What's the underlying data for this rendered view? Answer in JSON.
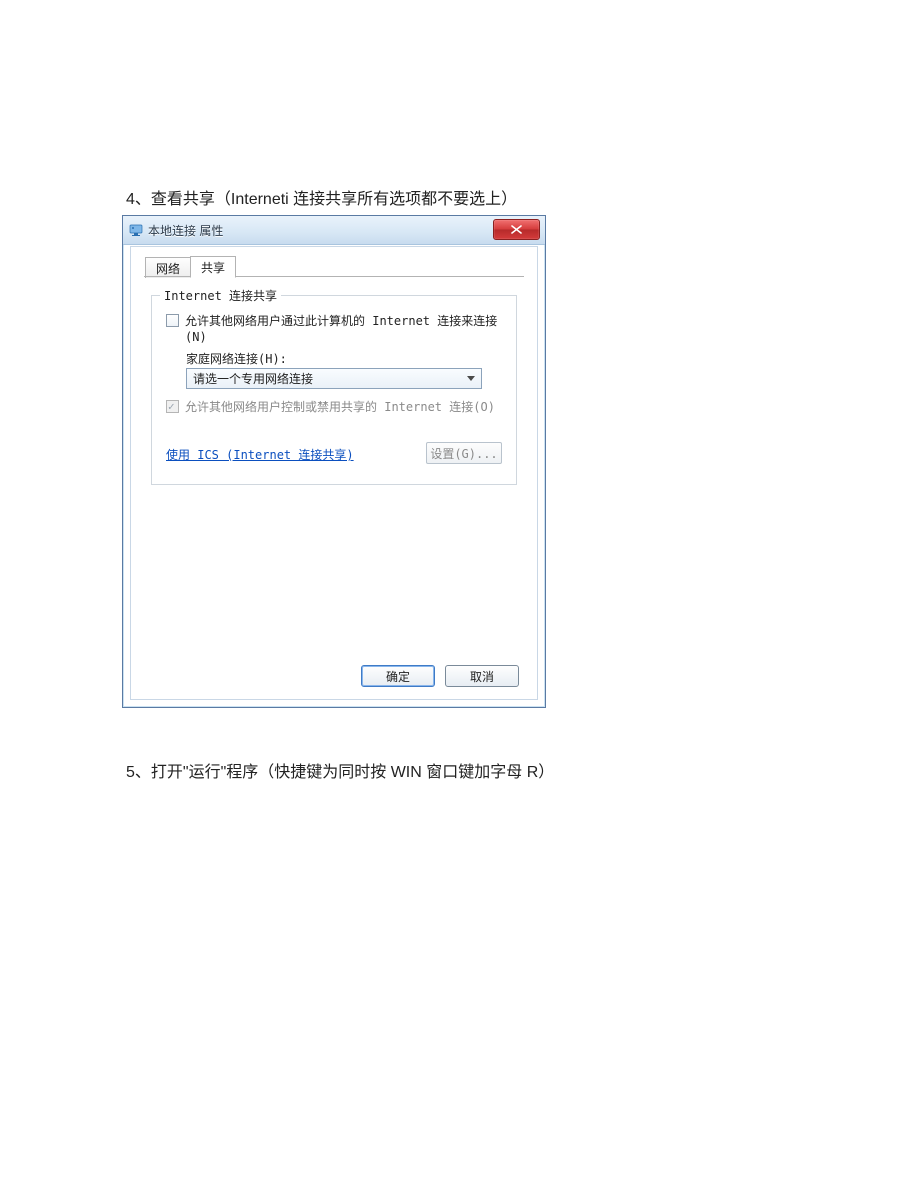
{
  "captions": {
    "step4": "4、查看共享（Interneti 连接共享所有选项都不要选上）",
    "step5": "5、打开\"运行\"程序（快捷键为同时按 WIN 窗口键加字母 R）"
  },
  "dialog": {
    "title": "本地连接 属性",
    "tabs": {
      "network": "网络",
      "share": "共享"
    },
    "group_title": "Internet 连接共享",
    "allow_through_label": "允许其他网络用户通过此计算机的 Internet 连接来连接(N)",
    "home_network_label": "家庭网络连接(H):",
    "combo_value": "请选一个专用网络连接",
    "allow_control_label": "允许其他网络用户控制或禁用共享的 Internet 连接(O)",
    "ics_link": "使用 ICS (Internet 连接共享)",
    "settings_button": "设置(G)...",
    "ok": "确定",
    "cancel": "取消"
  }
}
